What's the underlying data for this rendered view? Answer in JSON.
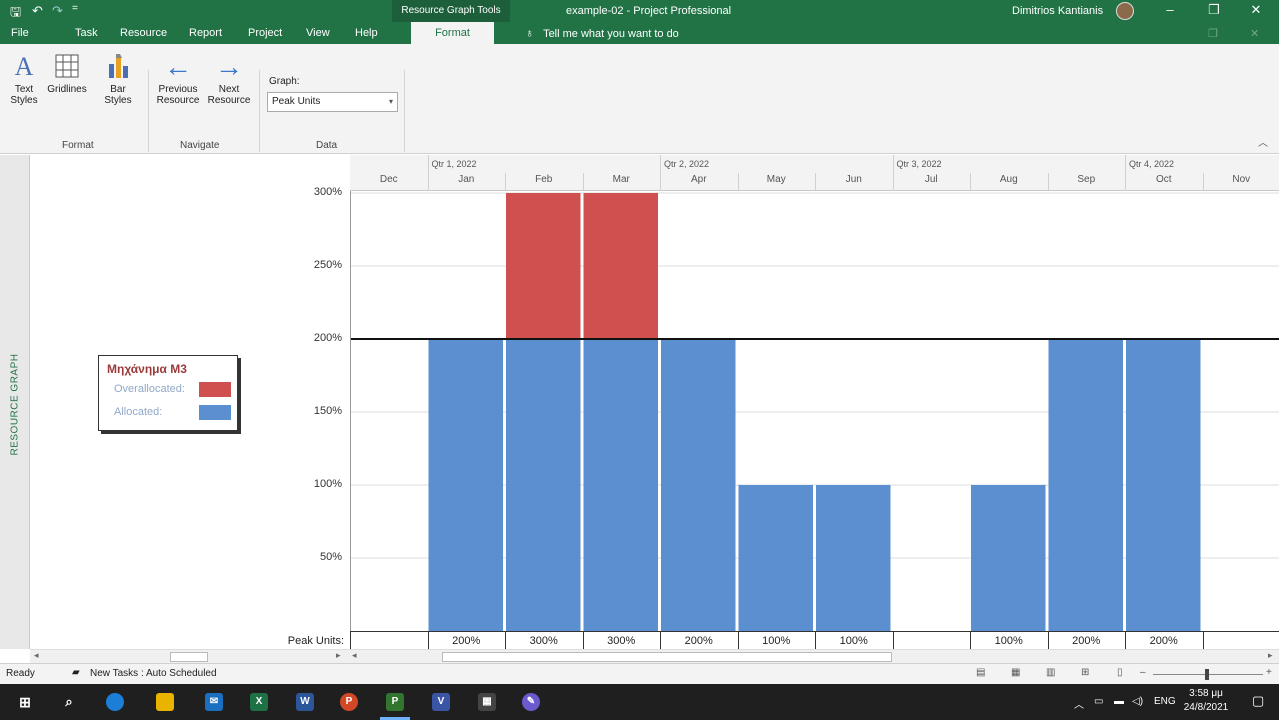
{
  "titlebar": {
    "context_tools": "Resource Graph Tools",
    "doc_title": "example-02  -  Project Professional",
    "user_name": "Dimitrios Kantianis",
    "qa_save": "🖫",
    "qa_undo": "↶",
    "qa_redo": "↷",
    "qa_more": "=",
    "min": "–",
    "restore": "❐",
    "close": "✕"
  },
  "menu": {
    "items": [
      "File",
      "Task",
      "Resource",
      "Report",
      "Project",
      "View",
      "Help"
    ],
    "active_tab": "Format",
    "tellme": "Tell me what you want to do"
  },
  "ribbon": {
    "text_styles": "Text Styles",
    "gridlines": "Gridlines",
    "bar_styles": "Bar Styles",
    "group_format": "Format",
    "previous_resource": "Previous Resource",
    "next_resource": "Next Resource",
    "group_navigate": "Navigate",
    "graph_label": "Graph:",
    "graph_value": "Peak Units",
    "group_data": "Data"
  },
  "viewbar": {
    "label": "RESOURCE GRAPH"
  },
  "legend": {
    "title": "Μηχάνημα M3",
    "overallocated": "Overallocated:",
    "allocated": "Allocated:"
  },
  "colors": {
    "allocated": "#5b8fd0",
    "overallocated": "#d05050",
    "brand": "#217346"
  },
  "timescale": {
    "quarters": [
      "Qtr 1, 2022",
      "Qtr 2, 2022",
      "Qtr 3, 2022",
      "Qtr 4, 2022"
    ],
    "months": [
      "Dec",
      "Jan",
      "Feb",
      "Mar",
      "Apr",
      "May",
      "Jun",
      "Jul",
      "Aug",
      "Sep",
      "Oct",
      "Nov"
    ]
  },
  "chart_data": {
    "type": "bar",
    "categories": [
      "Dec",
      "Jan",
      "Feb",
      "Mar",
      "Apr",
      "May",
      "Jun",
      "Jul",
      "Aug",
      "Sep",
      "Oct",
      "Nov"
    ],
    "series": [
      {
        "name": "Allocated",
        "values": [
          0,
          200,
          200,
          200,
          200,
          100,
          100,
          0,
          100,
          200,
          200,
          0
        ]
      },
      {
        "name": "Overallocated",
        "values": [
          0,
          0,
          100,
          100,
          0,
          0,
          0,
          0,
          0,
          0,
          0,
          0
        ]
      }
    ],
    "yticks": [
      "300%",
      "250%",
      "200%",
      "150%",
      "100%",
      "50%"
    ],
    "ylim": [
      0,
      300
    ],
    "max_units": 200,
    "row_label": "Peak Units:",
    "row_values": [
      "",
      "200%",
      "300%",
      "300%",
      "200%",
      "100%",
      "100%",
      "",
      "100%",
      "200%",
      "200%",
      ""
    ]
  },
  "status": {
    "ready": "Ready",
    "new_tasks": "New Tasks : Auto Scheduled"
  },
  "taskbar": {
    "lang": "ENG",
    "time": "3:58 μμ",
    "date": "24/8/2021"
  }
}
